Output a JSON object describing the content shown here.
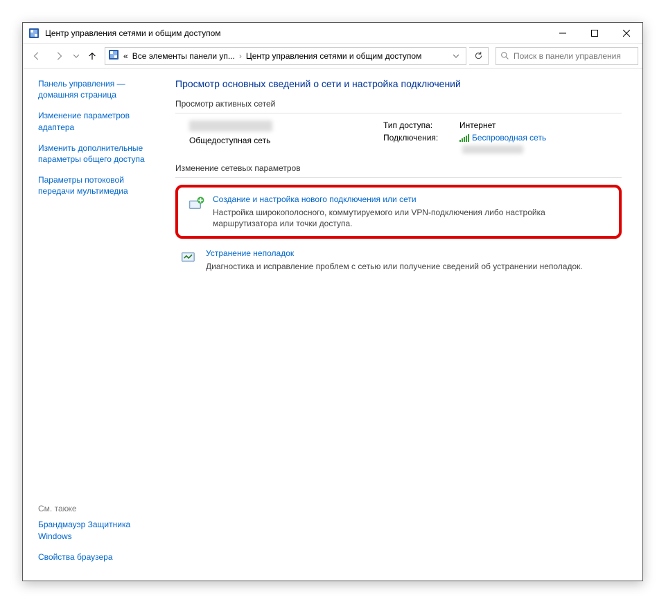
{
  "window": {
    "title": "Центр управления сетями и общим доступом"
  },
  "toolbar": {
    "breadcrumb_prefix": "«",
    "crumb1": "Все элементы панели уп...",
    "crumb2": "Центр управления сетями и общим доступом",
    "search_placeholder": "Поиск в панели управления"
  },
  "sidebar": {
    "links": [
      "Панель управления — домашняя страница",
      "Изменение параметров адаптера",
      "Изменить дополнительные параметры общего доступа",
      "Параметры потоковой передачи мультимедиа"
    ],
    "see_also_title": "См. также",
    "see_also": [
      "Брандмауэр Защитника Windows",
      "Свойства браузера"
    ]
  },
  "main": {
    "page_title": "Просмотр основных сведений о сети и настройка подключений",
    "active_networks_h": "Просмотр активных сетей",
    "network_type": "Общедоступная сеть",
    "access_label": "Тип доступа:",
    "access_value": "Интернет",
    "connections_label": "Подключения:",
    "connection_link": "Беспроводная сеть",
    "change_settings_h": "Изменение сетевых параметров",
    "task1_title": "Создание и настройка нового подключения или сети",
    "task1_desc": "Настройка широкополосного, коммутируемого или VPN-подключения либо настройка маршрутизатора или точки доступа.",
    "task2_title": "Устранение неполадок",
    "task2_desc": "Диагностика и исправление проблем с сетью или получение сведений об устранении неполадок."
  }
}
